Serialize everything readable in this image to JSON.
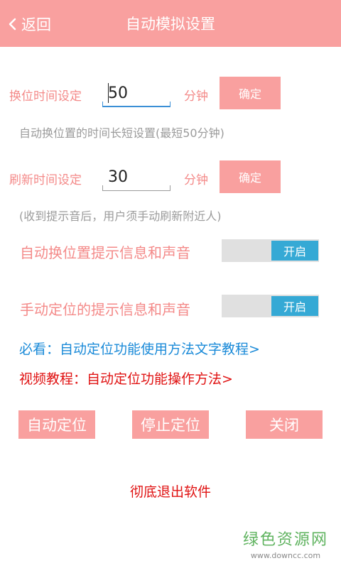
{
  "header": {
    "back_label": "返回",
    "title": "自动模拟设置"
  },
  "swap_time": {
    "label": "换位时间设定",
    "value": "50",
    "unit": "分钟",
    "confirm_label": "确定",
    "hint": "自动换位置的时间长短设置(最短50分钟)"
  },
  "refresh_time": {
    "label": "刷新时间设定",
    "value": "30",
    "unit": "分钟",
    "confirm_label": "确定",
    "hint": "(收到提示音后，用户须手动刷新附近人)"
  },
  "toggles": [
    {
      "label": "自动换位置提示信息和声音",
      "state_label": "开启"
    },
    {
      "label": "手动定位的提示信息和声音",
      "state_label": "开启"
    }
  ],
  "links": {
    "guide": "必看：自动定位功能使用方法文字教程>",
    "video": "视频教程：自动定位功能操作方法>"
  },
  "actions": {
    "auto_locate": "自动定位",
    "stop_locate": "停止定位",
    "close": "关闭"
  },
  "exit_label": "彻底退出软件",
  "watermark": {
    "main": "绿色资源网",
    "sub": "www.downcc.com"
  },
  "colors": {
    "accent": "#f9a09f",
    "label_pink": "#f48a89",
    "toggle_on": "#35a9d5",
    "link_blue": "#1a8ad8",
    "link_red": "#e01212"
  }
}
